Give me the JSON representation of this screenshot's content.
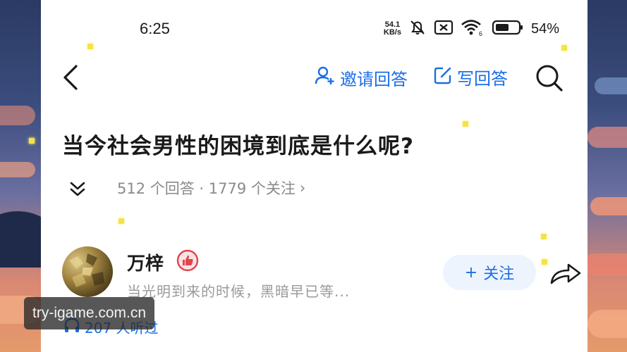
{
  "status_bar": {
    "time": "6:25",
    "net_speed_value": "54.1",
    "net_speed_unit": "KB/s",
    "battery_percent": "54%"
  },
  "nav": {
    "invite_label": "邀请回答",
    "write_label": "写回答"
  },
  "question": {
    "title": "当今社会男性的困境到底是什么呢?",
    "stats": "512 个回答 · 1779 个关注",
    "stats_chevron": "›"
  },
  "answer": {
    "author_name": "万梓",
    "author_bio": "当光明到来的时候，黑暗早已等...",
    "follow_label": "关注",
    "follow_plus": "+",
    "listeners": "207 人听过"
  },
  "watermark": {
    "text": "try-igame.com.cn"
  },
  "colors": {
    "accent": "#1a6fe8",
    "title": "#1a1a1a",
    "muted": "#8a8a8a",
    "badge": "#e0454f"
  }
}
